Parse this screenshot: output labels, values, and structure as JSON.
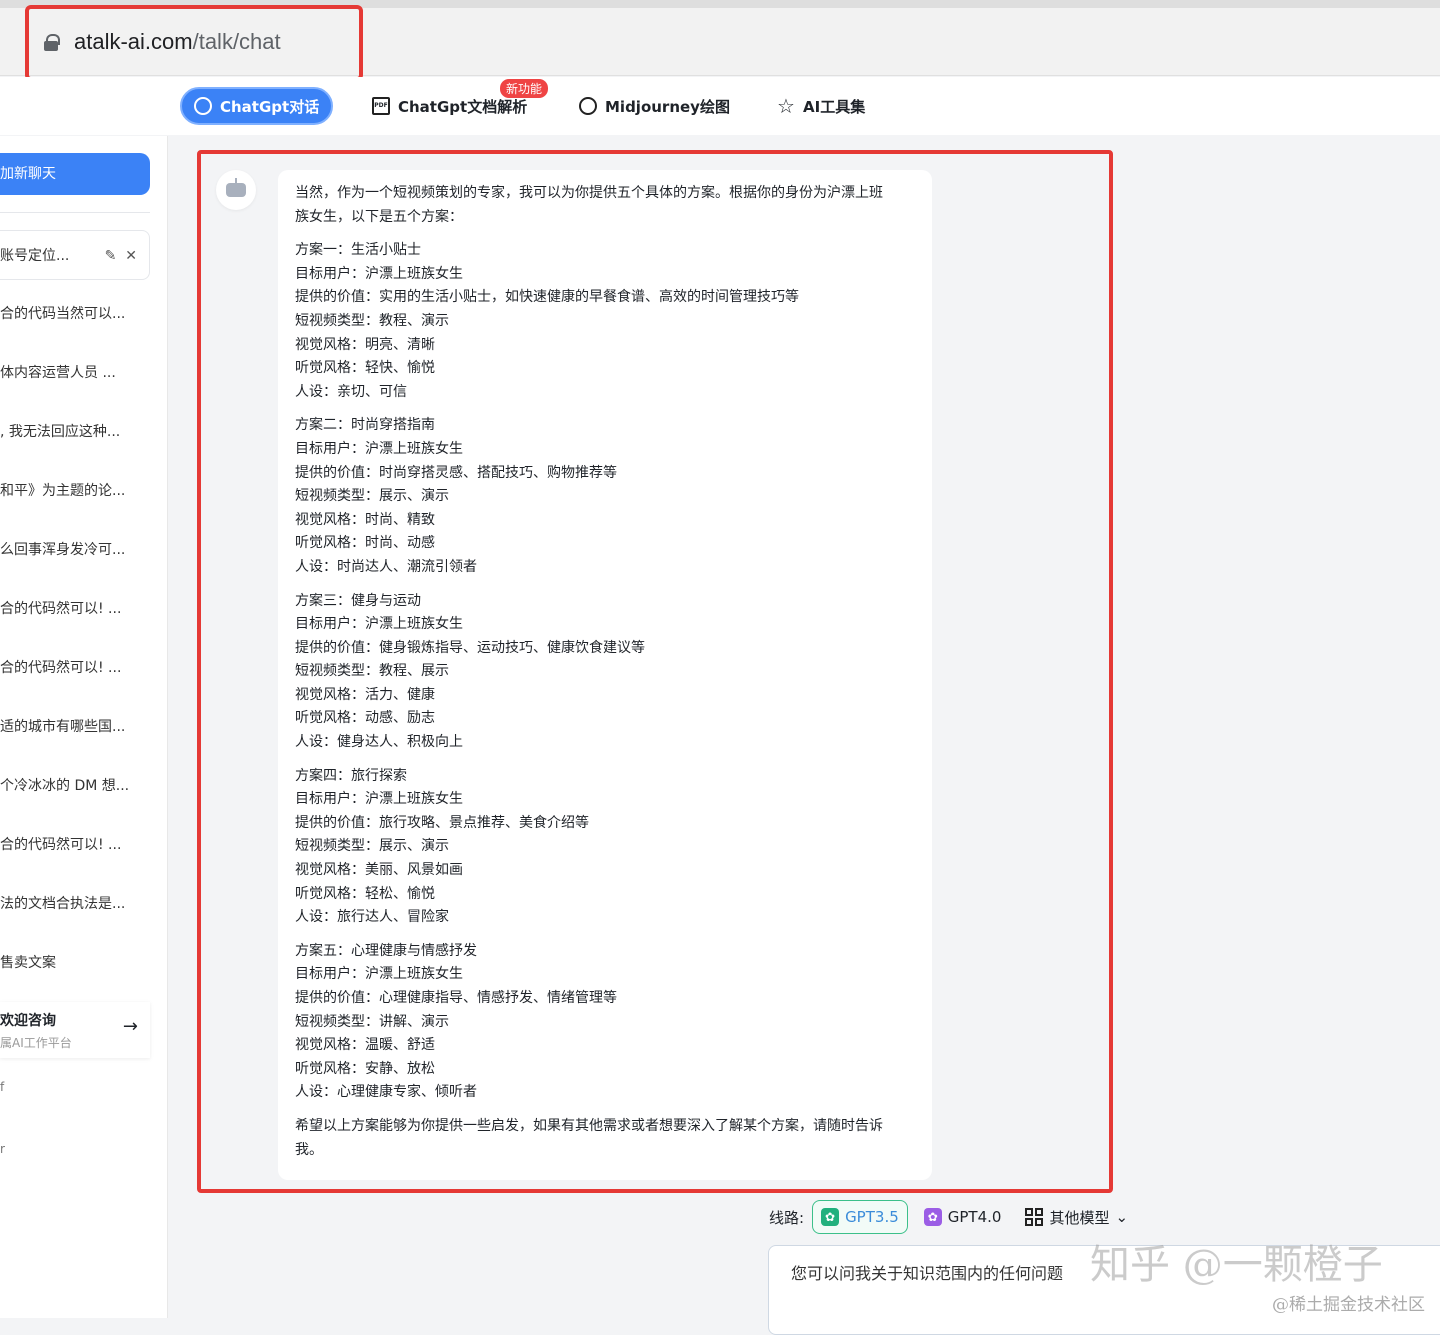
{
  "browser": {
    "host": "atalk-ai.com",
    "path": "/talk/chat"
  },
  "nav": {
    "tabs": [
      {
        "label": "ChatGpt对话",
        "icon": "chat-bubble-icon"
      },
      {
        "label": "ChatGpt文档解析",
        "icon": "pdf-icon"
      },
      {
        "label": "Midjourney绘图",
        "icon": "palette-icon"
      },
      {
        "label": "AI工具集",
        "icon": "star-icon"
      }
    ],
    "new_badge": "新功能"
  },
  "sidebar": {
    "new_chat": "加新聊天",
    "items": [
      "账号定位...",
      "合的代码当然可以...",
      "体内容运营人员 ...",
      ", 我无法回应这种...",
      "和平》为主题的论...",
      "么回事浑身发冷可...",
      "合的代码然可以! ...",
      "合的代码然可以! ...",
      "适的城市有哪些国...",
      "个冷冰冰的 DM 想...",
      "合的代码然可以! ...",
      "法的文档合执法是...",
      "售卖文案"
    ],
    "welcome_title": "欢迎咨询",
    "welcome_sub": "属AI工作平台",
    "mini": [
      "f",
      "r"
    ]
  },
  "message": {
    "intro": [
      "当然，作为一个短视频策划的专家，我可以为你提供五个具体的方案。根据你的身份为沪漂上班",
      "族女生，以下是五个方案："
    ],
    "plans": [
      [
        "方案一：生活小贴士",
        "目标用户：沪漂上班族女生",
        "提供的价值：实用的生活小贴士，如快速健康的早餐食谱、高效的时间管理技巧等",
        "短视频类型：教程、演示",
        "视觉风格：明亮、清晰",
        "听觉风格：轻快、愉悦",
        "人设：亲切、可信"
      ],
      [
        "方案二：时尚穿搭指南",
        "目标用户：沪漂上班族女生",
        "提供的价值：时尚穿搭灵感、搭配技巧、购物推荐等",
        "短视频类型：展示、演示",
        "视觉风格：时尚、精致",
        "听觉风格：时尚、动感",
        "人设：时尚达人、潮流引领者"
      ],
      [
        "方案三：健身与运动",
        "目标用户：沪漂上班族女生",
        "提供的价值：健身锻炼指导、运动技巧、健康饮食建议等",
        "短视频类型：教程、展示",
        "视觉风格：活力、健康",
        "听觉风格：动感、励志",
        "人设：健身达人、积极向上"
      ],
      [
        "方案四：旅行探索",
        "目标用户：沪漂上班族女生",
        "提供的价值：旅行攻略、景点推荐、美食介绍等",
        "短视频类型：展示、演示",
        "视觉风格：美丽、风景如画",
        "听觉风格：轻松、愉悦",
        "人设：旅行达人、冒险家"
      ],
      [
        "方案五：心理健康与情感抒发",
        "目标用户：沪漂上班族女生",
        "提供的价值：心理健康指导、情感抒发、情绪管理等",
        "短视频类型：讲解、演示",
        "视觉风格：温暖、舒适",
        "听觉风格：安静、放松",
        "人设：心理健康专家、倾听者"
      ]
    ],
    "outro": [
      "希望以上方案能够为你提供一些启发，如果有其他需求或者想要深入了解某个方案，请随时告诉",
      "我。"
    ]
  },
  "models": {
    "route_label": "线路:",
    "options": [
      "GPT3.5",
      "GPT4.0",
      "其他模型"
    ],
    "selected": "GPT3.5"
  },
  "input": {
    "placeholder": "您可以问我关于知识范围内的任何问题"
  },
  "watermark": {
    "main": "知乎 @一颗橙子",
    "sub": "@稀土掘金技术社区"
  }
}
